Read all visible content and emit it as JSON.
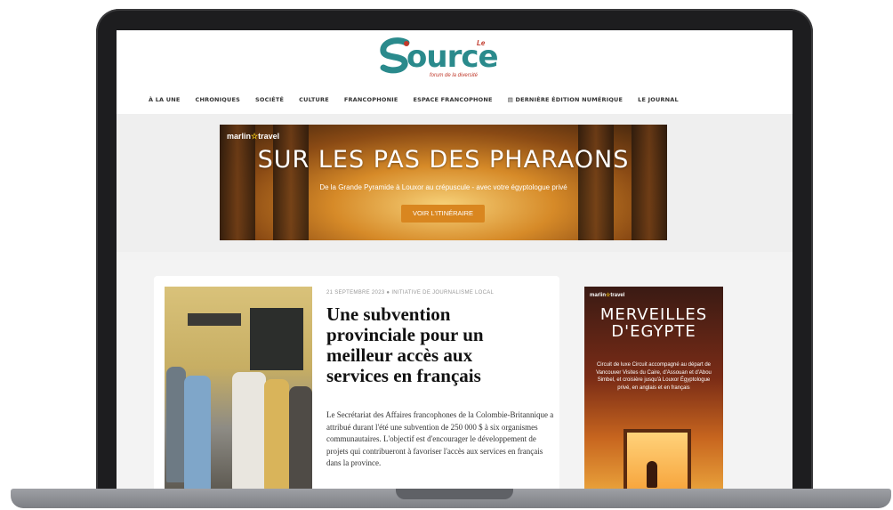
{
  "site": {
    "logo_main": "ource",
    "logo_le": "Le",
    "logo_tagline": "forum de la diversité"
  },
  "nav": {
    "items": [
      "À LA UNE",
      "CHRONIQUES",
      "SOCIÉTÉ",
      "CULTURE",
      "FRANCOPHONIE",
      "ESPACE FRANCOPHONE",
      "▤ DERNIÈRE ÉDITION NUMÉRIQUE",
      "LE JOURNAL"
    ]
  },
  "banner": {
    "brand": "marlin",
    "brand_suffix": "travel",
    "title": "SUR LES PAS DES PHARAONS",
    "subtitle": "De la Grande Pyramide à Louxor au crépuscule - avec votre égyptologue privé",
    "button": "VOIR L'ITINÉRAIRE"
  },
  "article": {
    "meta": "21 SEPTEMBRE 2023 ● INITIATIVE DE JOURNALISME LOCAL",
    "headline": "Une subvention provinciale pour un meilleur accès aux services en français",
    "excerpt": "Le Secrétariat des Affaires francophones de la Colombie-Britannique a attribué durant l'été une subvention de 250 000 $ à six organismes communautaires. L'objectif est d'encourager le développement de projets qui contribueront à favoriser l'accès aux services en français dans la province."
  },
  "side_ad": {
    "brand": "marlin",
    "brand_suffix": "travel",
    "title": "MERVEILLES D'EGYPTE",
    "text": "Circuit de luxe Circuit accompagné au départ de Vancouver Visites du Caire, d'Assouan et d'Abou Simbel, et croisière jusqu'à Louxor Égyptologue privé, en anglais et en français"
  },
  "colors": {
    "brand_teal": "#2a8a8c",
    "brand_red": "#c0392b",
    "button_orange": "#d9861f"
  }
}
